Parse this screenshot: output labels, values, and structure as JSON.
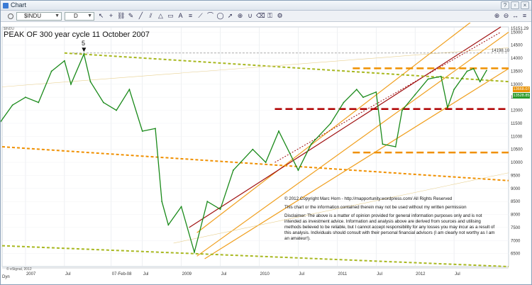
{
  "window": {
    "title": "Chart"
  },
  "toolbar": {
    "symbol": "$INDU",
    "interval": "D"
  },
  "annotations": {
    "title": "PEAK OF 300 year cycle 11 October 2007",
    "wave_label": "5",
    "resistance_label": "14198.10",
    "price_box_current": "13528.85",
    "price_box_upper": "13668.07",
    "esignal": "© eSignal, 2012",
    "dyn": "Dyn"
  },
  "disclaimer": {
    "copyright": "© 2012 Copyright Marc Horn - http://mapportunity.wordpress.com/  All Rights Reserved",
    "permission": "This chart or the information contained therein may not be used without my written permission",
    "text": "Disclaimer: The above is a matter of opinion provided for general information purposes only and is not intended as investment advice. Information and analysis above are derived from sources and utilising methods believed to be reliable, but I cannot accept responsibility for any losses you may incur as a result of this analysis. Individuals should consult with their personal financial advisors (I am clearly not worthy as I am an amateur!)."
  },
  "colors": {
    "price": "#1a8a1a",
    "channel_orange": "#f0a020",
    "channel_red": "#a01010",
    "dashed_olive": "#a8b820",
    "dashed_orange": "#f09000",
    "dashed_red": "#b00000",
    "price_box_green": "#2a9a2a",
    "price_box_orange": "#e89000"
  },
  "chart_data": {
    "type": "line",
    "title": "PEAK OF 300 year cycle 11 October 2007",
    "y_ticks": [
      6500,
      7000,
      7500,
      8000,
      8500,
      9000,
      9500,
      10000,
      10500,
      11000,
      11500,
      12000,
      12500,
      13000,
      13500,
      14000,
      14500,
      15000
    ],
    "y_top_label": "15151.29",
    "ylim": [
      6000,
      15200
    ],
    "x_ticks": [
      "2007",
      "Jul",
      "07-Feb-08",
      "Jul",
      "2009",
      "Jul",
      "2010",
      "Jul",
      "2011",
      "Jul",
      "2012",
      "Jul"
    ],
    "series": [
      {
        "values": [
          [
            "2006-09",
            11500
          ],
          [
            "2006-11",
            12200
          ],
          [
            "2007-01",
            12500
          ],
          [
            "2007-03",
            12300
          ],
          [
            "2007-05",
            13500
          ],
          [
            "2007-07",
            13900
          ],
          [
            "2007-08",
            13000
          ],
          [
            "2007-10",
            14160
          ],
          [
            "2007-11",
            13100
          ],
          [
            "2008-01",
            12300
          ],
          [
            "2008-03",
            12000
          ],
          [
            "2008-05",
            12800
          ],
          [
            "2008-07",
            11200
          ],
          [
            "2008-09",
            11300
          ],
          [
            "2008-10",
            8500
          ],
          [
            "2008-11",
            7600
          ],
          [
            "2009-01",
            8300
          ],
          [
            "2009-03",
            6550
          ],
          [
            "2009-05",
            8500
          ],
          [
            "2009-07",
            8200
          ],
          [
            "2009-09",
            9700
          ],
          [
            "2009-12",
            10500
          ],
          [
            "2010-02",
            10000
          ],
          [
            "2010-04",
            11200
          ],
          [
            "2010-07",
            9700
          ],
          [
            "2010-09",
            10700
          ],
          [
            "2010-12",
            11500
          ],
          [
            "2011-02",
            12300
          ],
          [
            "2011-04",
            12800
          ],
          [
            "2011-05",
            12500
          ],
          [
            "2011-07",
            12700
          ],
          [
            "2011-08",
            10700
          ],
          [
            "2011-10",
            10600
          ],
          [
            "2011-11",
            12000
          ],
          [
            "2012-01",
            12600
          ],
          [
            "2012-03",
            13200
          ],
          [
            "2012-05",
            13300
          ],
          [
            "2012-06",
            12100
          ],
          [
            "2012-07",
            12800
          ],
          [
            "2012-09",
            13500
          ],
          [
            "2012-10",
            13600
          ],
          [
            "2012-11",
            13100
          ],
          [
            "2012-12",
            13528.85
          ]
        ]
      }
    ],
    "horizontal_levels": [
      {
        "value": 14198.1,
        "style": "dashed-gray"
      },
      {
        "value": 13610,
        "style": "dashed-orange"
      },
      {
        "value": 12050,
        "style": "dashed-red"
      },
      {
        "value": 10380,
        "style": "dashed-orange"
      }
    ],
    "grid": true
  }
}
